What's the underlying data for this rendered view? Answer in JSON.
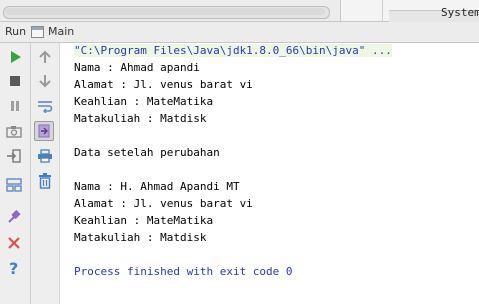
{
  "top_panel": {
    "label": "System"
  },
  "run_header": {
    "run_label": "Run",
    "tab_label": "Main"
  },
  "tools_left": [
    {
      "name": "rerun-icon",
      "color": "#3aa33a"
    },
    {
      "name": "stop-icon",
      "color": "#5a5a5a"
    },
    {
      "name": "pause-icon",
      "color": "#a0a0a0"
    },
    {
      "name": "camera-icon",
      "color": "#8a8a8a"
    },
    {
      "name": "login-icon",
      "color": "#7a7a7a"
    },
    {
      "name": "layout-icon",
      "color": "#5b8ac4"
    },
    {
      "name": "pin-icon",
      "color": "#8d6ac0"
    },
    {
      "name": "close-icon",
      "color": "#d9534f"
    },
    {
      "name": "help-icon",
      "color": "#3f7fd0"
    }
  ],
  "tools_right": [
    {
      "name": "up-arrow-icon"
    },
    {
      "name": "down-arrow-icon"
    },
    {
      "name": "soft-wrap-icon"
    },
    {
      "name": "scroll-to-end-icon"
    },
    {
      "name": "print-icon"
    },
    {
      "name": "trash-icon"
    }
  ],
  "console": {
    "command": "\"C:\\Program Files\\Java\\jdk1.8.0_66\\bin\\java\" ...",
    "lines": [
      "Nama : Ahmad apandi",
      "Alamat : Jl. venus barat vi",
      "Keahlian : MateMatika",
      "Matakuliah : Matdisk",
      "",
      "Data setelah perubahan",
      "",
      "Nama : H. Ahmad Apandi MT",
      "Alamat : Jl. venus barat vi",
      "Keahlian : MateMatika",
      "Matakuliah : Matdisk",
      "",
      "Process finished with exit code 0"
    ]
  },
  "colors": {
    "console_text": "#000000",
    "command_text": "#2a37b8",
    "command_bg": "#eef7e4",
    "exit_text": "#2a37b8"
  }
}
